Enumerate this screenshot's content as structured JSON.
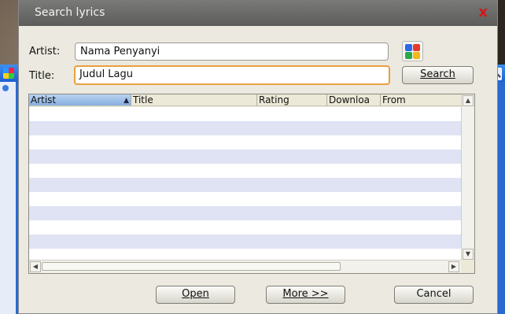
{
  "dialog": {
    "title": "Search lyrics",
    "close_label": "x"
  },
  "form": {
    "artist_label": "Artist:",
    "artist_value": "Nama Penyanyi",
    "title_label": "Title:",
    "title_value": "Judul Lagu",
    "search_button": "Search",
    "google_icon": "google-icon"
  },
  "table": {
    "columns": [
      "Artist",
      "Title",
      "Rating",
      "Downloa",
      "From"
    ],
    "sorted_column": "Artist",
    "sort_direction": "ascending",
    "rows": []
  },
  "buttons": {
    "open": "Open",
    "more": "More >>",
    "cancel": "Cancel"
  },
  "colors": {
    "close": "#d01818",
    "focus_border": "#e8a040",
    "row_stripe": "#dfe3f4"
  }
}
